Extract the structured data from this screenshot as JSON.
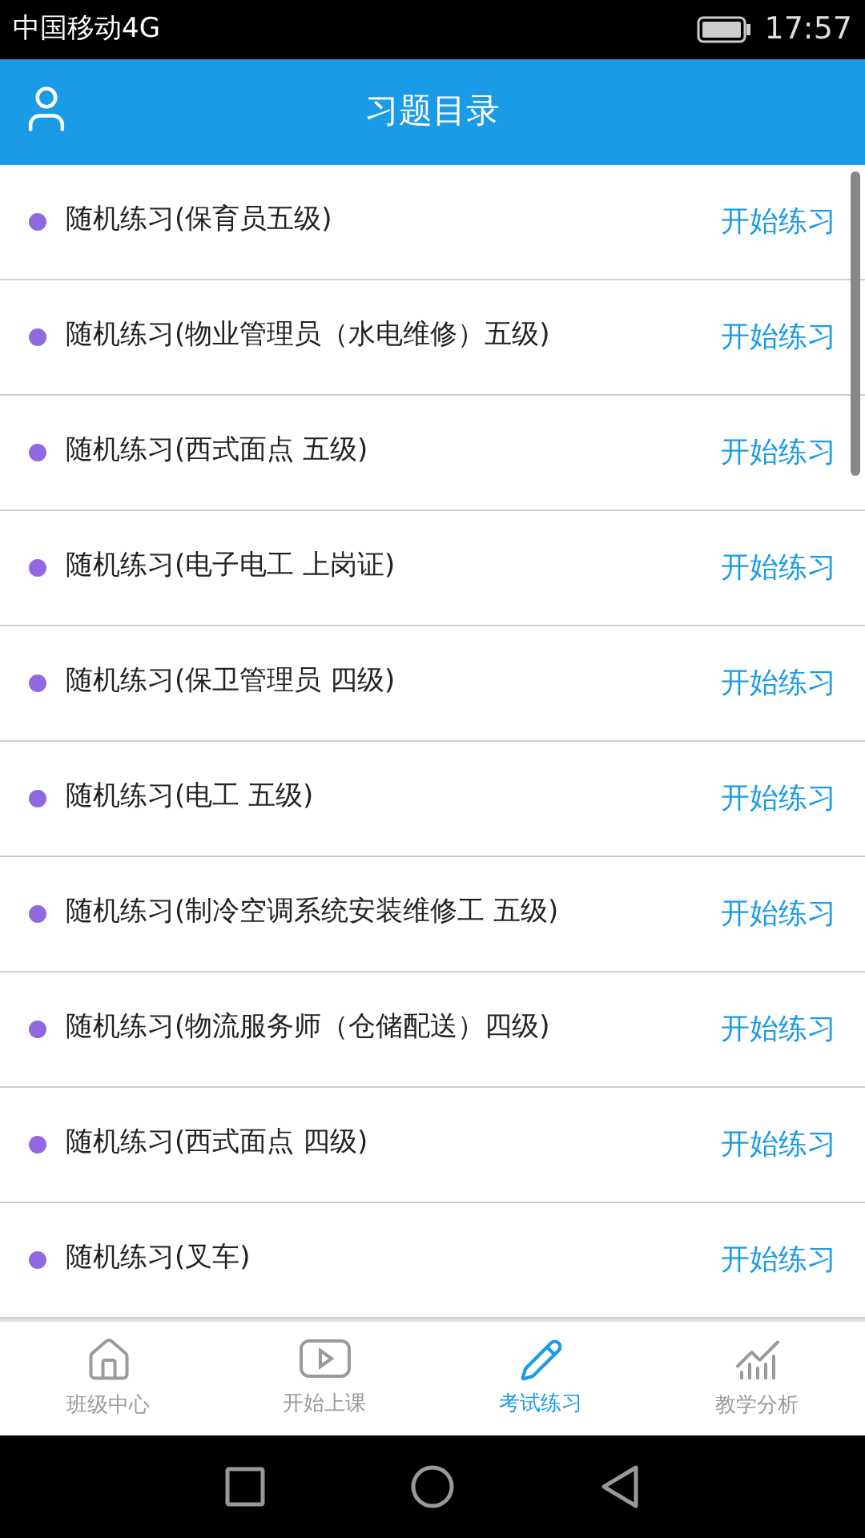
{
  "status_bar": {
    "carrier": "中国移动4G",
    "time": "17:57"
  },
  "header": {
    "title": "习题目录"
  },
  "items": [
    {
      "title": "随机练习(保育员五级)",
      "action": "开始练习"
    },
    {
      "title": "随机练习(物业管理员（水电维修）五级)",
      "action": "开始练习"
    },
    {
      "title": "随机练习(西式面点 五级)",
      "action": "开始练习"
    },
    {
      "title": "随机练习(电子电工 上岗证)",
      "action": "开始练习"
    },
    {
      "title": "随机练习(保卫管理员 四级)",
      "action": "开始练习"
    },
    {
      "title": "随机练习(电工 五级)",
      "action": "开始练习"
    },
    {
      "title": "随机练习(制冷空调系统安装维修工 五级)",
      "action": "开始练习"
    },
    {
      "title": "随机练习(物流服务师（仓储配送）四级)",
      "action": "开始练习"
    },
    {
      "title": "随机练习(西式面点 四级)",
      "action": "开始练习"
    },
    {
      "title": "随机练习(叉车)",
      "action": "开始练习"
    }
  ],
  "tabs": [
    {
      "kind": "home",
      "label": "班级中心",
      "selected": false
    },
    {
      "kind": "play",
      "label": "开始上课",
      "selected": false
    },
    {
      "kind": "pencil",
      "label": "考试练习",
      "selected": true
    },
    {
      "kind": "chart",
      "label": "教学分析",
      "selected": false
    }
  ]
}
